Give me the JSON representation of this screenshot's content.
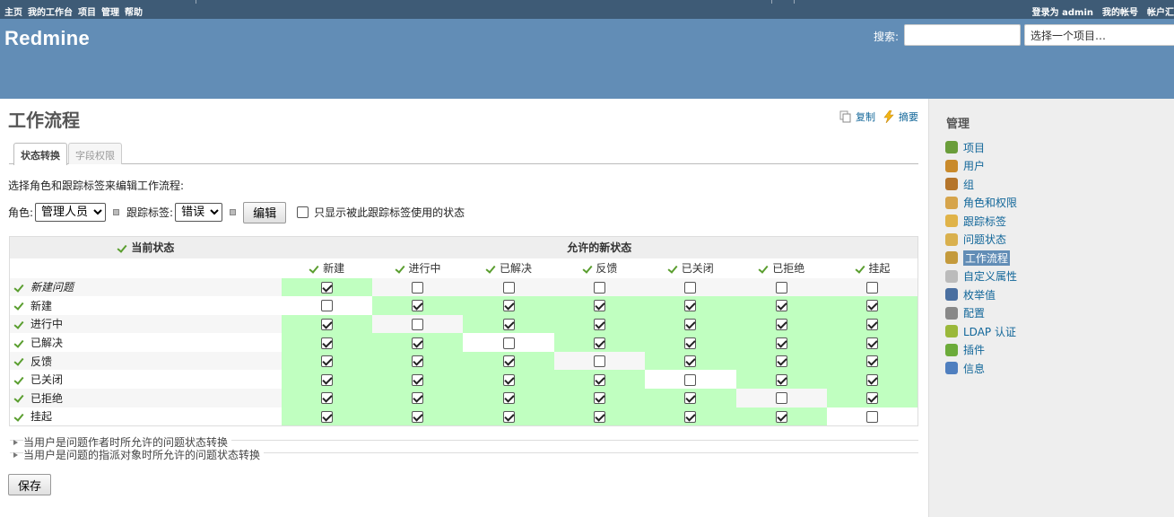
{
  "top_menu": {
    "left": [
      "主页",
      "我的工作台",
      "项目",
      "管理",
      "帮助"
    ],
    "logged_in_as": "登录为",
    "user": "admin",
    "my_account": "我的帐号",
    "account_summary": "帐户汇"
  },
  "header": {
    "title": "Redmine",
    "search_label": "搜索:",
    "search_value": "",
    "project_jump": "选择一个项目…"
  },
  "page": {
    "title": "工作流程",
    "actions": {
      "copy": "复制",
      "summary": "摘要"
    },
    "tabs": [
      "状态转换",
      "字段权限"
    ],
    "hint": "选择角色和跟踪标签来编辑工作流程:",
    "role_label": "角色:",
    "role_value": "管理人员",
    "tracker_label": "跟踪标签:",
    "tracker_value": "错误",
    "edit_button": "编辑",
    "only_used_label": "只显示被此跟踪标签使用的状态",
    "save_button": "保存"
  },
  "workflow": {
    "current_status_header": "当前状态",
    "new_status_header": "允许的新状态",
    "columns": [
      "新建",
      "进行中",
      "已解决",
      "反馈",
      "已关闭",
      "已拒绝",
      "挂起"
    ],
    "rows": [
      {
        "name": "新建问题",
        "italic": true,
        "checks": [
          true,
          false,
          false,
          false,
          false,
          false,
          false
        ]
      },
      {
        "name": "新建",
        "italic": false,
        "checks": [
          false,
          true,
          true,
          true,
          true,
          true,
          true
        ]
      },
      {
        "name": "进行中",
        "italic": false,
        "checks": [
          true,
          false,
          true,
          true,
          true,
          true,
          true
        ]
      },
      {
        "name": "已解决",
        "italic": false,
        "checks": [
          true,
          true,
          false,
          true,
          true,
          true,
          true
        ]
      },
      {
        "name": "反馈",
        "italic": false,
        "checks": [
          true,
          true,
          true,
          false,
          true,
          true,
          true
        ]
      },
      {
        "name": "已关闭",
        "italic": false,
        "checks": [
          true,
          true,
          true,
          true,
          false,
          true,
          true
        ]
      },
      {
        "name": "已拒绝",
        "italic": false,
        "checks": [
          true,
          true,
          true,
          true,
          true,
          false,
          true
        ]
      },
      {
        "name": "挂起",
        "italic": false,
        "checks": [
          true,
          true,
          true,
          true,
          true,
          true,
          false
        ]
      }
    ]
  },
  "collapsed_sections": [
    "当用户是问题作者时所允许的问题状态转换",
    "当用户是问题的指派对象时所允许的问题状态转换"
  ],
  "sidebar": {
    "title": "管理",
    "items": [
      {
        "label": "项目",
        "icon": "projects-icon",
        "color": "#6a9d3a"
      },
      {
        "label": "用户",
        "icon": "user-icon",
        "color": "#c98a2b"
      },
      {
        "label": "组",
        "icon": "group-icon",
        "color": "#b5752b"
      },
      {
        "label": "角色和权限",
        "icon": "roles-icon",
        "color": "#d6a44b"
      },
      {
        "label": "跟踪标签",
        "icon": "trackers-icon",
        "color": "#e0b348"
      },
      {
        "label": "问题状态",
        "icon": "issue-statuses-icon",
        "color": "#d9b04d"
      },
      {
        "label": "工作流程",
        "icon": "workflow-icon",
        "color": "#c49a3c",
        "selected": true
      },
      {
        "label": "自定义属性",
        "icon": "custom-fields-icon",
        "color": "#bbbbbb"
      },
      {
        "label": "枚举值",
        "icon": "enumerations-icon",
        "color": "#4a6fa0"
      },
      {
        "label": "配置",
        "icon": "settings-icon",
        "color": "#888888"
      },
      {
        "label": "LDAP 认证",
        "icon": "ldap-icon",
        "color": "#9ab83a"
      },
      {
        "label": "插件",
        "icon": "plugins-icon",
        "color": "#6cab3a"
      },
      {
        "label": "信息",
        "icon": "info-icon",
        "color": "#4f7fbf"
      }
    ]
  },
  "colors": {
    "top_menu_bg": "#3e5b76",
    "header_bg": "#628db6",
    "link": "#116699",
    "enabled_cell": "#c0ffc0"
  }
}
